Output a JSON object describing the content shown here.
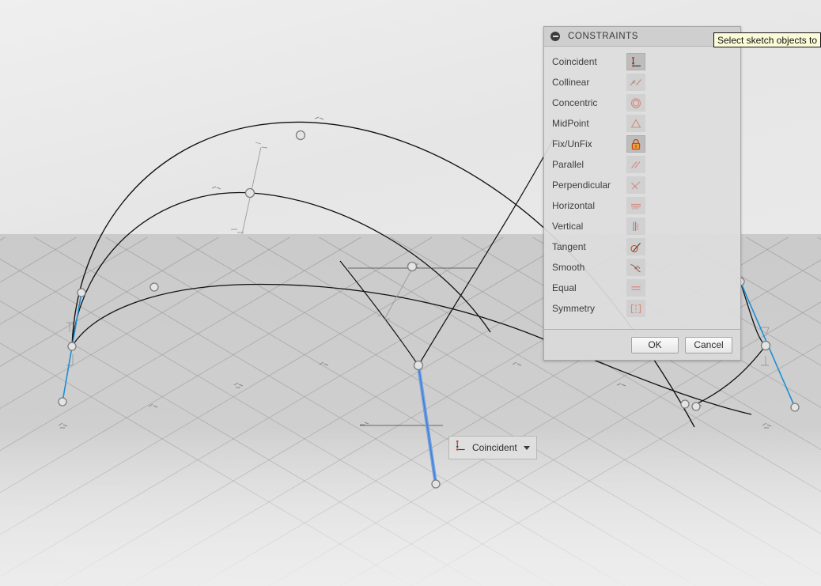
{
  "viewport": {
    "background_top": "#ededed",
    "background_bottom": "#e9e9e9",
    "grid_color": "#b0b0b0",
    "curve_color": "#1a1a1a",
    "construction_color": "#1f8ed4",
    "node_color": "#8a8a8a"
  },
  "panel": {
    "title": "CONSTRAINTS",
    "collapse_icon": "minus-circle-icon",
    "items": [
      {
        "label": "Coincident",
        "icon": "coincident-icon",
        "selected": true
      },
      {
        "label": "Collinear",
        "icon": "collinear-icon",
        "selected": false
      },
      {
        "label": "Concentric",
        "icon": "concentric-icon",
        "selected": false
      },
      {
        "label": "MidPoint",
        "icon": "midpoint-icon",
        "selected": false
      },
      {
        "label": "Fix/UnFix",
        "icon": "lock-icon",
        "selected": true
      },
      {
        "label": "Parallel",
        "icon": "parallel-icon",
        "selected": false
      },
      {
        "label": "Perpendicular",
        "icon": "perpendicular-icon",
        "selected": false
      },
      {
        "label": "Horizontal",
        "icon": "horizontal-icon",
        "selected": false
      },
      {
        "label": "Vertical",
        "icon": "vertical-icon",
        "selected": false
      },
      {
        "label": "Tangent",
        "icon": "tangent-icon",
        "selected": false
      },
      {
        "label": "Smooth",
        "icon": "smooth-icon",
        "selected": false
      },
      {
        "label": "Equal",
        "icon": "equal-icon",
        "selected": false
      },
      {
        "label": "Symmetry",
        "icon": "symmetry-icon",
        "selected": false
      }
    ],
    "ok_label": "OK",
    "cancel_label": "Cancel"
  },
  "tooltip": {
    "text": "Select sketch objects to"
  },
  "hud": {
    "icon": "coincident-icon",
    "label": "Coincident",
    "caret": "chevron-down-icon"
  }
}
